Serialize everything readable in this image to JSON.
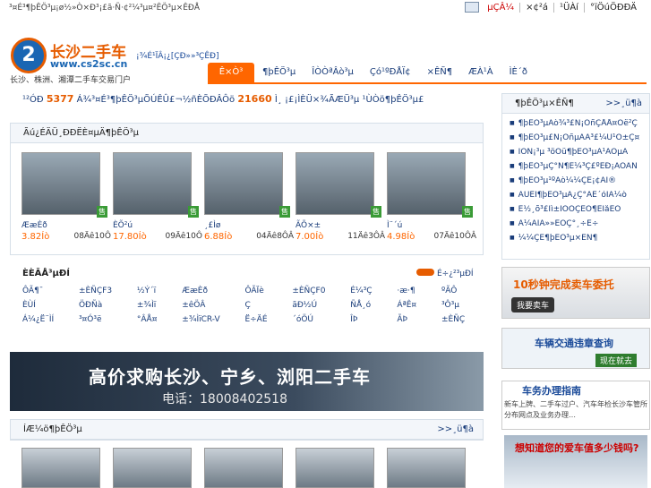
{
  "top": {
    "tagline": "³¤É³¶þÊÖ³µ¡ø½»Ò×Ð³¡£ã·Ñ·¢²¼³µ¤²ÊÖ³µ×ÊÐÅ",
    "links": [
      "µÇÂ¼",
      "×¢²á",
      "¹ÜÀí",
      "°ïÖúÖÐÐÄ"
    ]
  },
  "logo": {
    "badge": "2",
    "title": "长沙二手车",
    "url": "www.cs2sc.cn",
    "slogan": "长沙、株洲、湘潭二手车交易门户"
  },
  "sublink": "¡¾É¹ÏÂ¡¿[ÇÐ»»³ÇÊÐ]",
  "nav": [
    "Ê×Ò³",
    "¶þÊÖ³µ",
    "ÎÒÒªÂò³µ",
    "Çó¹ºÐÅÏ¢",
    "×ÊÑ¶",
    "ÆÀ¹À",
    "ÌÈ´ð"
  ],
  "stats": {
    "before": "¹²ÓÐ",
    "count1": "5377",
    "middle": "Á¾³¤É³¶þÊÖ³µÕÚÊÛ£¬½ñÈÕÐÂÔö",
    "count2": "21660",
    "after": "Ì¸ ¡£¡ÌÈÜ×¾ÃÆÜ³µ ¹ÙÒö¶þÊÖ³µ£"
  },
  "recommend": {
    "title": "Ãú¿ÉÄÜ¸ÐÐËÈ¤µÄ¶þÊÖ³µ",
    "badge": "售",
    "cars": [
      {
        "name": "ÆæÈð",
        "price": "3.82Íò",
        "date": "08Äê10Ô"
      },
      {
        "name": "ÈÕ²ú",
        "price": "17.80Íò",
        "date": "09Äê10Ô"
      },
      {
        "name": "¸£Ìø",
        "price": "6.88Íò",
        "date": "04Äê8ÔÂ"
      },
      {
        "name": "ÃÕ×±",
        "price": "7.00Íò",
        "date": "11Äê3ÔÂ"
      },
      {
        "name": "Ì¨´ú",
        "price": "4.98Íò",
        "date": "07Äê10ÔÂ"
      }
    ]
  },
  "brands": {
    "title": "ÈÈÃÅ³µÐÍ",
    "more": "É÷¿²³µÐÍ",
    "items": [
      "ÔÃ¶¯",
      "±ÈÑÇF3",
      "½Ý´ï",
      "ÆæÈð",
      "ÔÃÏè",
      "±ÈÑÇF0",
      "É¼³Ç",
      "·æ·¶",
      "ºÃÔ",
      "ÈÙÍ",
      "ÖÐÑà",
      "±¾Ìï",
      "±êÖÂ",
      "Ç",
      "ãÐ½Ú",
      "ÑÅ¸ó",
      "ÁªÊ¤",
      "³Ô³µ",
      "Á¼¿Ë¨ÌÍ",
      "³¤Ó³ë",
      "°ÂÅ¤",
      "±¾ÌïCR-V",
      "Ë÷ÄÉ",
      "´óÖÚ",
      "ÎÞ",
      "ÃÞ",
      "±ÈÑÇ"
    ]
  },
  "banner": {
    "headline": "高价求购长沙、宁乡、浏阳二手车",
    "phone": "电话：18008402518"
  },
  "hot": {
    "title": "ÍÆ¼ö¶þÊÖ³µ",
    "more": ">>¸ü¶à"
  },
  "side": {
    "title": "¶þÊÖ³µ×ÊÑ¶",
    "more": ">>¸ü¶à",
    "items": [
      "¶þÊÖ³µÂò¾³£Ñ¡ÔñÇÅÅ¤Óë²Ç",
      "¶þÊÖ³µ£Ñ¡ÔñµÄÄ³£¼Ú¹Ô±Ç¤",
      "ÌÔÑ¡³µ ³öÕü¶þÊÖ³µÃ¹ÄÖµÄ",
      "¶þÊÖ³µÇ°Ñ¶Ê¼³Ç£ºÊÐ¡ÃÕÄÑ",
      "¶þÊÖ³µ¹ºÂò¼¼ÇÉ¡¢ÀÍ®",
      "ÃÜÈÏ¶þÊÖ³µÄ¿Ç°ÁË´óÏÂ¼ò",
      "É½¸õ³£Ìì±ÌÒÔÇÊÓ¶ÈÌåÊÔ",
      "À¼ÂÌÃ»»ÊÖÇ°¸÷Ë÷",
      "¼¼ÇÉ¶þÊÖ³µ×ÊÑ¶"
    ]
  },
  "ads": {
    "sell": {
      "title": "10秒钟完成卖车委托",
      "button": "我要卖车"
    },
    "traffic": {
      "title": "车辆交通违章查询",
      "button": "现在就去"
    },
    "service": {
      "title": "车务办理指南",
      "desc": "新车上牌、二手车过户、汽车年检长沙车管所分布网点及业务办理…"
    },
    "value": {
      "title": "想知道您的爱车值多少钱吗?"
    }
  }
}
